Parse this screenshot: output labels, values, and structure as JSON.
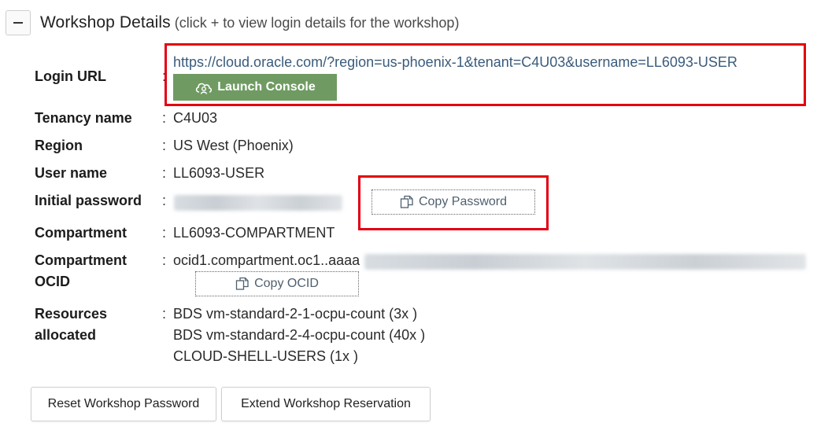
{
  "header": {
    "title": "Workshop Details",
    "hint": "(click + to view login details for the workshop)"
  },
  "login": {
    "label": "Login URL",
    "url": "https://cloud.oracle.com/?region=us-phoenix-1&tenant=C4U03&username=LL6093-USER",
    "launch_label": "Launch Console"
  },
  "tenancy": {
    "label": "Tenancy name",
    "value": "C4U03"
  },
  "region": {
    "label": "Region",
    "value": "US West (Phoenix)"
  },
  "username": {
    "label": "User name",
    "value": "LL6093-USER"
  },
  "password": {
    "label": "Initial password",
    "copy_label": "Copy Password"
  },
  "compartment": {
    "label": "Compartment",
    "value": "LL6093-COMPARTMENT"
  },
  "compartment_ocid": {
    "label_line1": "Compartment",
    "label_line2": "OCID",
    "value": "ocid1.compartment.oc1..aaaa",
    "copy_label": "Copy OCID"
  },
  "resources": {
    "label_line1": "Resources",
    "label_line2": "allocated",
    "items": [
      "BDS vm-standard-2-1-ocpu-count (3x )",
      "BDS vm-standard-2-4-ocpu-count (40x )",
      "CLOUD-SHELL-USERS (1x )"
    ]
  },
  "actions": {
    "reset_label": "Reset Workshop Password",
    "extend_label": "Extend Workshop Reservation"
  },
  "colors": {
    "launch_button": "#6f9b62",
    "highlight_box": "#e3000f",
    "link": "#3a5b7c"
  },
  "colon": ":"
}
